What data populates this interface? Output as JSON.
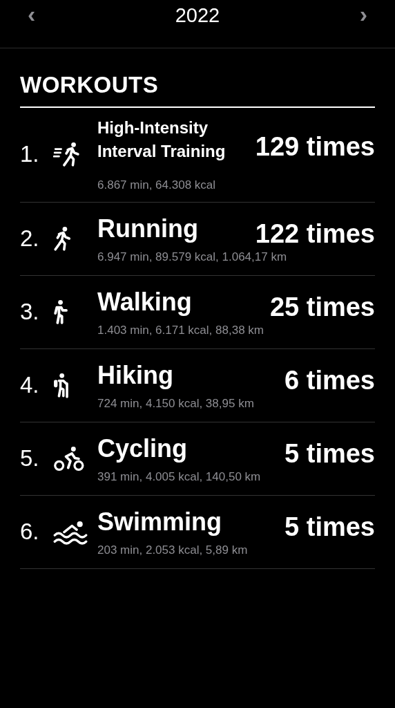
{
  "header": {
    "year": "2022",
    "prev": "‹",
    "next": "›"
  },
  "section": {
    "title": "WORKOUTS"
  },
  "workouts": [
    {
      "rank": "1.",
      "kind": "hiit",
      "name": "High-Intensity Interval Training",
      "stats": "6.867 min, 64.308 kcal",
      "count": "129 times"
    },
    {
      "rank": "2.",
      "kind": "running",
      "name": "Running",
      "stats": "6.947 min, 89.579 kcal, 1.064,17 km",
      "count": "122 times"
    },
    {
      "rank": "3.",
      "kind": "walking",
      "name": "Walking",
      "stats": "1.403 min, 6.171 kcal, 88,38 km",
      "count": "25 times"
    },
    {
      "rank": "4.",
      "kind": "hiking",
      "name": "Hiking",
      "stats": "724 min, 4.150 kcal, 38,95 km",
      "count": "6 times"
    },
    {
      "rank": "5.",
      "kind": "cycling",
      "name": "Cycling",
      "stats": "391 min, 4.005 kcal, 140,50 km",
      "count": "5 times"
    },
    {
      "rank": "6.",
      "kind": "swimming",
      "name": "Swimming",
      "stats": "203 min, 2.053 kcal, 5,89 km",
      "count": "5 times"
    }
  ]
}
